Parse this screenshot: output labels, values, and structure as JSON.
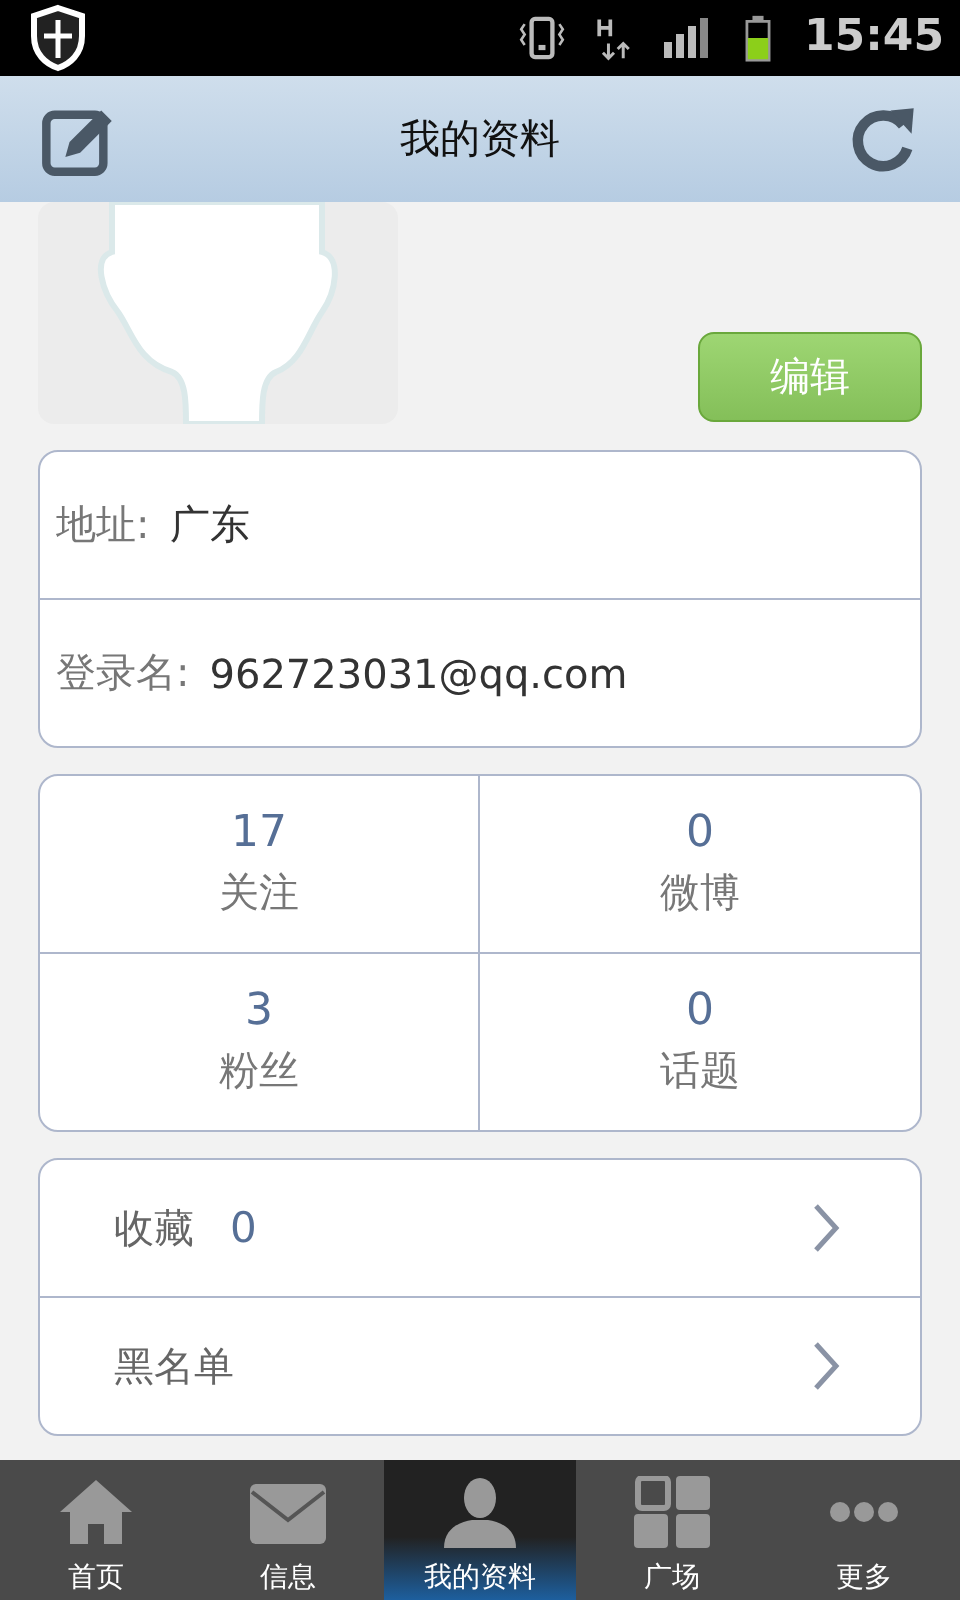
{
  "status_bar": {
    "time": "15:45"
  },
  "header": {
    "title": "我的资料"
  },
  "profile": {
    "edit_button": "编辑"
  },
  "info": [
    {
      "label": "地址:",
      "value": "广东"
    },
    {
      "label": "登录名:",
      "value": "962723031@qq.com"
    }
  ],
  "stats": [
    {
      "count": "17",
      "label": "关注"
    },
    {
      "count": "0",
      "label": "微博"
    },
    {
      "count": "3",
      "label": "粉丝"
    },
    {
      "count": "0",
      "label": "话题"
    }
  ],
  "menu": [
    {
      "label": "收藏",
      "value": "0"
    },
    {
      "label": "黑名单"
    }
  ],
  "tabs": [
    {
      "label": "首页",
      "kind": "home",
      "selected": false
    },
    {
      "label": "信息",
      "kind": "mail",
      "selected": false
    },
    {
      "label": "我的资料",
      "kind": "person",
      "selected": true
    },
    {
      "label": "广场",
      "kind": "grid",
      "selected": false
    },
    {
      "label": "更多",
      "kind": "more",
      "selected": false
    }
  ]
}
